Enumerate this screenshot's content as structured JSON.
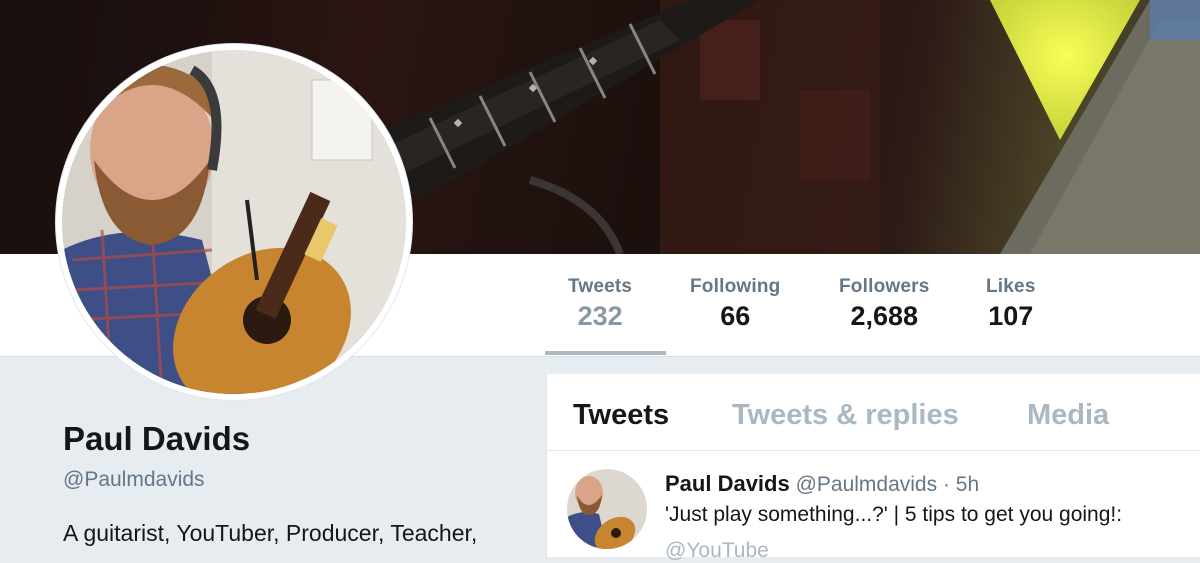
{
  "profile": {
    "name": "Paul Davids",
    "handle": "@Paulmdavids",
    "bio": "A guitarist, YouTuber, Producer, Teacher,"
  },
  "stats": [
    {
      "label": "Tweets",
      "value": "232",
      "active": true
    },
    {
      "label": "Following",
      "value": "66"
    },
    {
      "label": "Followers",
      "value": "2,688"
    },
    {
      "label": "Likes",
      "value": "107"
    }
  ],
  "tabs": [
    {
      "label": "Tweets",
      "active": true
    },
    {
      "label": "Tweets & replies"
    },
    {
      "label": "Media"
    }
  ],
  "tweet": {
    "name": "Paul Davids",
    "handle": "@Paulmdavids",
    "separator": "·",
    "time": "5h",
    "text": "'Just play something...?' | 5 tips to get you going!:",
    "link": "@YouTube"
  },
  "colors": {
    "primary_text": "#14171a",
    "secondary_text": "#657786",
    "muted": "#aab8c2",
    "page_bg": "#e6ecf0"
  }
}
